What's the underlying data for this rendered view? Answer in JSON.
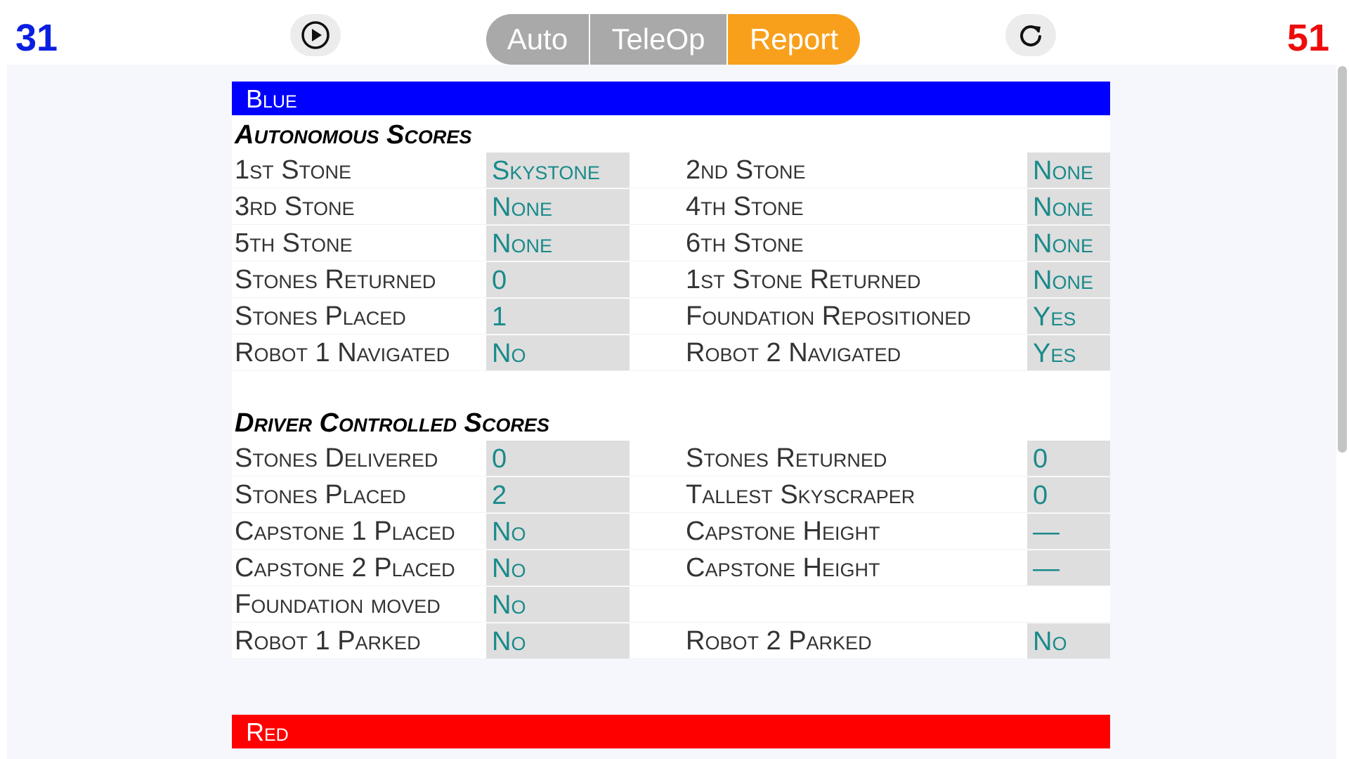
{
  "header": {
    "blue_score": "31",
    "red_score": "51",
    "play_icon": "play-circle-icon",
    "reload_icon": "refresh-icon",
    "tabs": [
      {
        "label": "Auto",
        "active": false
      },
      {
        "label": "TeleOp",
        "active": false
      },
      {
        "label": "Report",
        "active": true
      }
    ],
    "colors": {
      "blue_score": "#0a1fe0",
      "red_score": "#ee0c0c",
      "active_tab": "#f8a01c",
      "inactive_tab": "#a9a9a9"
    }
  },
  "blue": {
    "title": "Blue",
    "color": "#0000ff",
    "autonomous": {
      "title": "Autonomous Scores",
      "rows": [
        {
          "l1": "1st Stone",
          "v1": "Skystone",
          "l2": "2nd Stone",
          "v2": "None"
        },
        {
          "l1": "3rd Stone",
          "v1": "None",
          "l2": "4th Stone",
          "v2": "None"
        },
        {
          "l1": "5th Stone",
          "v1": "None",
          "l2": "6th Stone",
          "v2": "None"
        },
        {
          "l1": "Stones Returned",
          "v1": "0",
          "l2": "1st Stone Returned",
          "v2": "None"
        },
        {
          "l1": "Stones Placed",
          "v1": "1",
          "l2": "Foundation Repositioned",
          "v2": "Yes"
        },
        {
          "l1": "Robot 1 Navigated",
          "v1": "No",
          "l2": "Robot 2 Navigated",
          "v2": "Yes"
        }
      ]
    },
    "driver": {
      "title": "Driver Controlled Scores",
      "rows": [
        {
          "l1": "Stones Delivered",
          "v1": "0",
          "l2": "Stones Returned",
          "v2": "0"
        },
        {
          "l1": "Stones Placed",
          "v1": "2",
          "l2": "Tallest Skyscraper",
          "v2": "0"
        },
        {
          "l1": "Capstone 1 Placed",
          "v1": "No",
          "l2": "Capstone Height",
          "v2": "—"
        },
        {
          "l1": "Capstone 2 Placed",
          "v1": "No",
          "l2": "Capstone Height",
          "v2": "—"
        },
        {
          "l1": "Foundation moved",
          "v1": "No",
          "l2": "",
          "v2": ""
        },
        {
          "l1": "Robot 1 Parked",
          "v1": "No",
          "l2": "Robot 2 Parked",
          "v2": "No"
        }
      ]
    }
  },
  "red": {
    "title": "Red",
    "color": "#ff0000"
  }
}
